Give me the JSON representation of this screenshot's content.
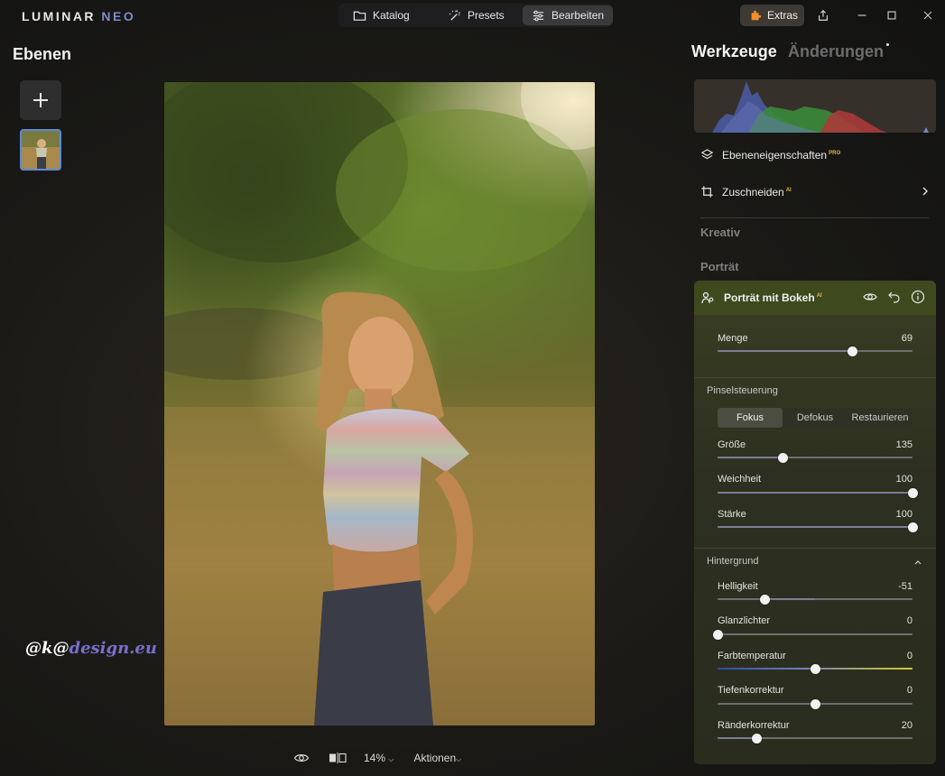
{
  "app": {
    "logo_main": "LUMINAR",
    "logo_accent": " NEO"
  },
  "nav": {
    "tabs": [
      {
        "label": "Katalog",
        "icon": "folder-icon"
      },
      {
        "label": "Presets",
        "icon": "magic-wand-icon"
      },
      {
        "label": "Bearbeiten",
        "icon": "sliders-icon",
        "active": true
      }
    ]
  },
  "titlebar": {
    "extras_label": "Extras"
  },
  "layers": {
    "title": "Ebenen"
  },
  "watermark": {
    "prefix": "@k@",
    "suffix": "design.eu"
  },
  "bottombar": {
    "zoom": "14%",
    "actions": "Aktionen"
  },
  "right_panel": {
    "tab_tools": "Werkzeuge",
    "tab_changes": "Änderungen",
    "tool_items": [
      {
        "label": "Ebeneneigenschaften",
        "badge": "PRO"
      },
      {
        "label": "Zuschneiden",
        "badge": "AI"
      }
    ],
    "sections": {
      "creative": "Kreativ",
      "portrait": "Porträt"
    },
    "active_tool": {
      "title": "Porträt mit Bokeh",
      "badge": "AI",
      "amount": {
        "label": "Menge",
        "value": 69
      },
      "brush": {
        "title": "Pinselsteuerung",
        "modes": [
          "Fokus",
          "Defokus",
          "Restaurieren"
        ],
        "active_mode": "Fokus",
        "size": {
          "label": "Größe",
          "value": 135
        },
        "softness": {
          "label": "Weichheit",
          "value": 100
        },
        "strength": {
          "label": "Stärke",
          "value": 100
        }
      },
      "background": {
        "title": "Hintergrund",
        "brightness": {
          "label": "Helligkeit",
          "value": -51
        },
        "highlights": {
          "label": "Glanzlichter",
          "value": 0
        },
        "temperature": {
          "label": "Farbtemperatur",
          "value": 0
        },
        "depth": {
          "label": "Tiefenkorrektur",
          "value": 0
        },
        "edges": {
          "label": "Ränderkorrektur",
          "value": 20
        }
      }
    }
  },
  "colors": {
    "accent": "#5a8ad6",
    "pro_badge": "#e0b840",
    "panel_header": "#3e4a1e"
  }
}
